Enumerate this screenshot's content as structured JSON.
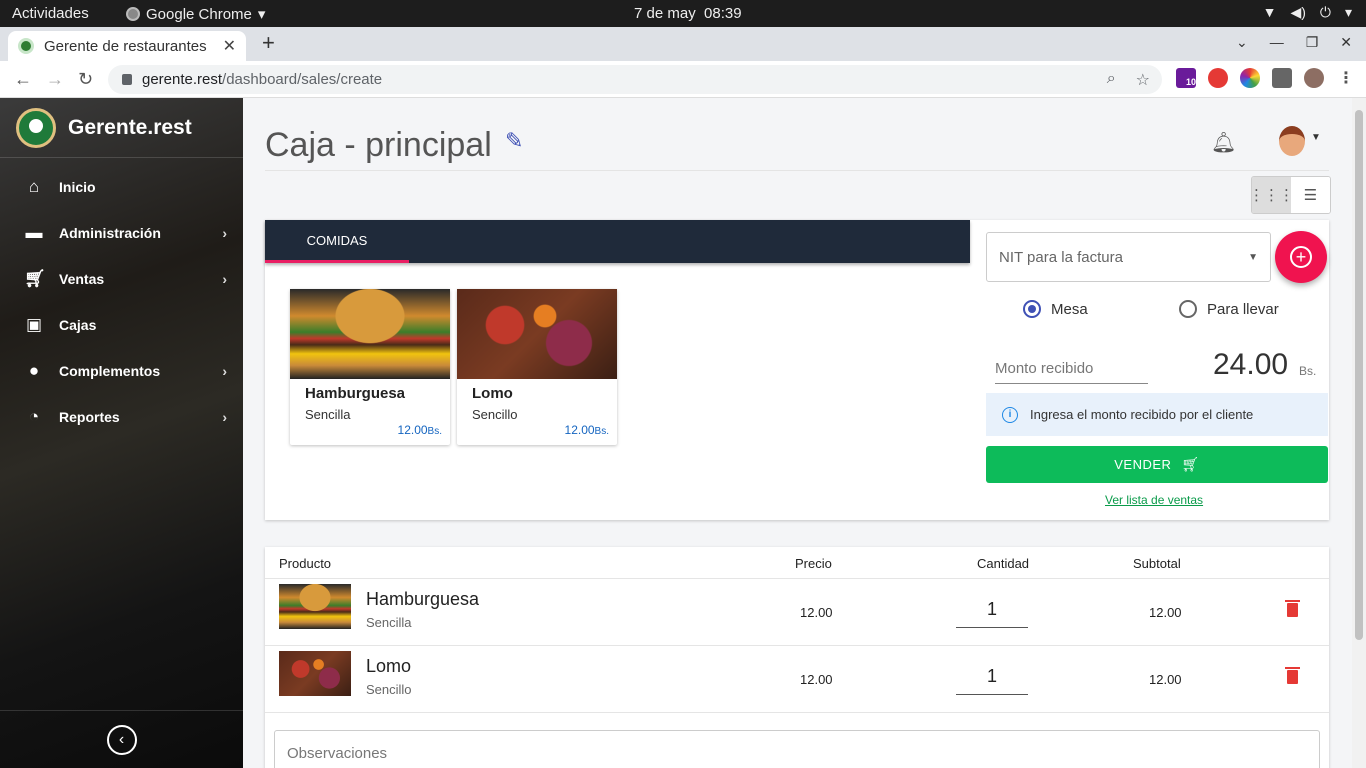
{
  "system": {
    "activities": "Actividades",
    "app_name": "Google Chrome",
    "date": "7 de may",
    "time": "08:39"
  },
  "browser": {
    "tab_title": "Gerente de restaurantes",
    "url_host": "gerente.rest",
    "url_path": "/dashboard/sales/create",
    "ext_badge": "10"
  },
  "sidebar": {
    "brand": "Gerente.rest",
    "items": [
      {
        "label": "Inicio",
        "icon": "home-icon",
        "has_submenu": false
      },
      {
        "label": "Administración",
        "icon": "briefcase-icon",
        "has_submenu": true
      },
      {
        "label": "Ventas",
        "icon": "cart-icon",
        "has_submenu": true
      },
      {
        "label": "Cajas",
        "icon": "cash-icon",
        "has_submenu": false
      },
      {
        "label": "Complementos",
        "icon": "lightbulb-icon",
        "has_submenu": true
      },
      {
        "label": "Reportes",
        "icon": "pie-chart-icon",
        "has_submenu": true
      }
    ]
  },
  "header": {
    "title": "Caja - principal"
  },
  "categories": [
    {
      "label": "COMIDAS",
      "active": true
    }
  ],
  "products": [
    {
      "name": "Hamburguesa",
      "desc": "Sencilla",
      "price": "12.00",
      "currency": "Bs."
    },
    {
      "name": "Lomo",
      "desc": "Sencillo",
      "price": "12.00",
      "currency": "Bs."
    }
  ],
  "checkout": {
    "nit_placeholder": "NIT para la factura",
    "order_type_options": [
      "Mesa",
      "Para llevar"
    ],
    "order_type_selected": "Mesa",
    "monto_placeholder": "Monto recibido",
    "total": "24.00",
    "currency": "Bs.",
    "info_text": "Ingresa el monto recibido por el cliente",
    "sell_label": "VENDER",
    "sales_list_link": "Ver lista de ventas"
  },
  "cart_table": {
    "headers": {
      "product": "Producto",
      "price": "Precio",
      "quantity": "Cantidad",
      "subtotal": "Subtotal"
    },
    "rows": [
      {
        "name": "Hamburguesa",
        "desc": "Sencilla",
        "price": "12.00",
        "qty": "1",
        "subtotal": "12.00"
      },
      {
        "name": "Lomo",
        "desc": "Sencillo",
        "price": "12.00",
        "qty": "1",
        "subtotal": "12.00"
      }
    ],
    "notes_placeholder": "Observaciones"
  },
  "colors": {
    "accent_pink": "#f0134f",
    "sell_green": "#0dbb5a",
    "nav_dark": "#1f2a3a",
    "radio_indigo": "#3f51b5"
  }
}
